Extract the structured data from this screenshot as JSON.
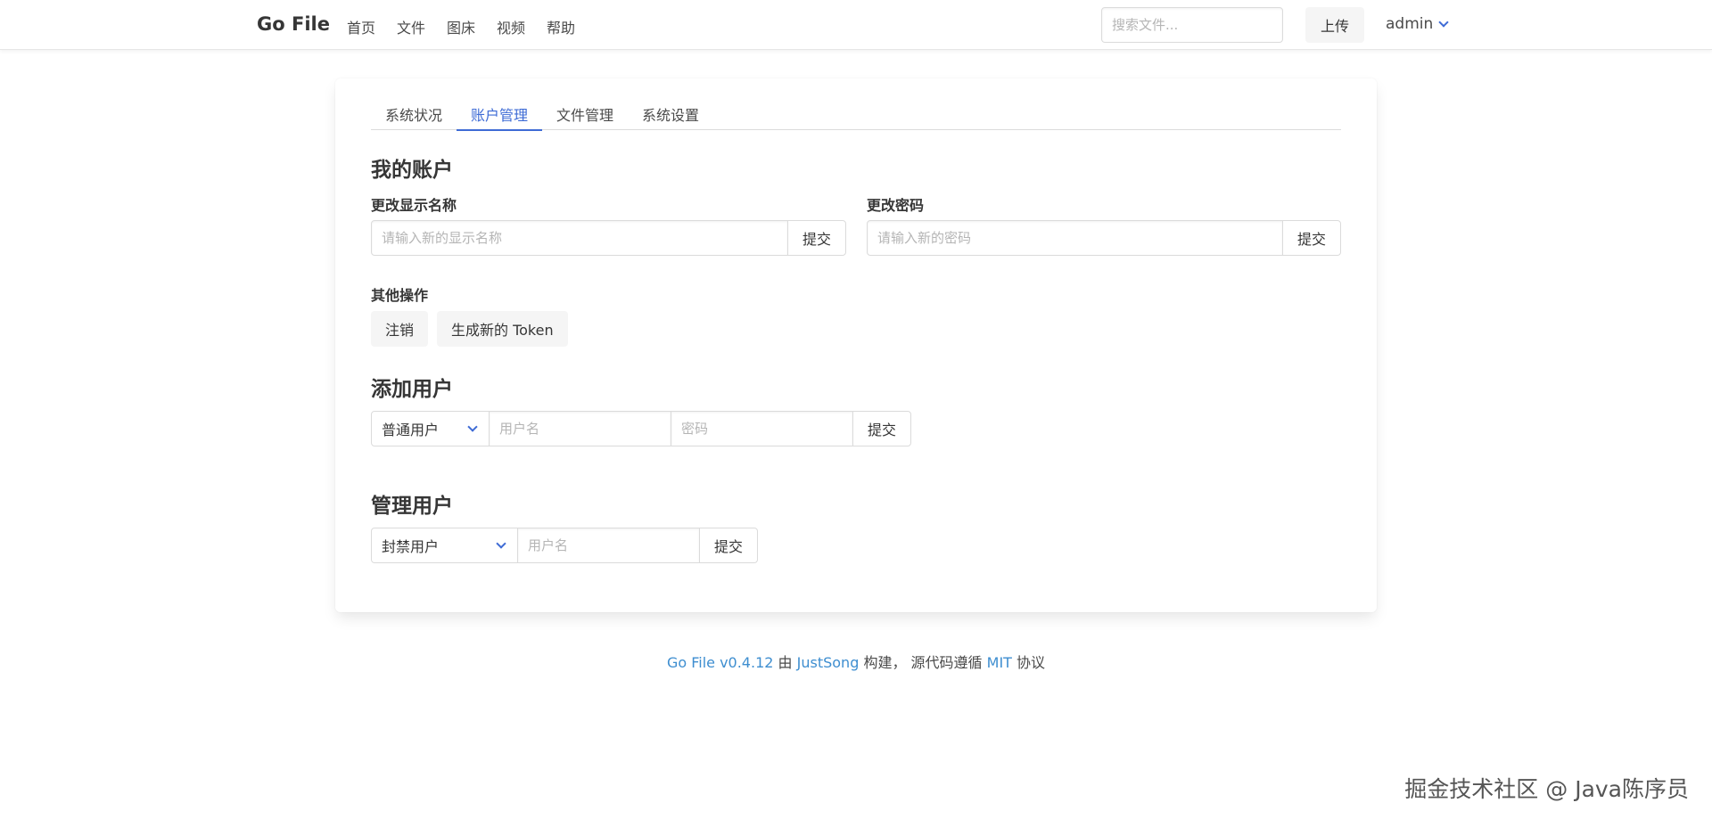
{
  "navbar": {
    "brand": "Go File",
    "links": [
      "首页",
      "文件",
      "图床",
      "视频",
      "帮助"
    ],
    "search_placeholder": "搜索文件...",
    "upload_label": "上传",
    "user_label": "admin"
  },
  "tabs": [
    "系统状况",
    "账户管理",
    "文件管理",
    "系统设置"
  ],
  "active_tab": "账户管理",
  "my_account": {
    "title": "我的账户",
    "change_name_label": "更改显示名称",
    "change_name_placeholder": "请输入新的显示名称",
    "change_name_submit": "提交",
    "change_password_label": "更改密码",
    "change_password_placeholder": "请输入新的密码",
    "change_password_submit": "提交",
    "other_ops_label": "其他操作",
    "logout_label": "注销",
    "new_token_label": "生成新的 Token"
  },
  "add_user": {
    "title": "添加用户",
    "role_selected": "普通用户",
    "username_placeholder": "用户名",
    "password_placeholder": "密码",
    "submit": "提交"
  },
  "manage_user": {
    "title": "管理用户",
    "action_selected": "封禁用户",
    "username_placeholder": "用户名",
    "submit": "提交"
  },
  "footer": {
    "app_link": "Go File v0.4.12",
    "by_text": "由",
    "author_link": "JustSong",
    "built_text": "构建，  源代码遵循",
    "license_link": "MIT",
    "license_text": "协议"
  },
  "watermark": "掘金技术社区 @ Java陈序员",
  "colors": {
    "accent": "#3e6bd5",
    "link": "#3e8ed0",
    "text": "#363636",
    "border": "#dbdbdb"
  }
}
